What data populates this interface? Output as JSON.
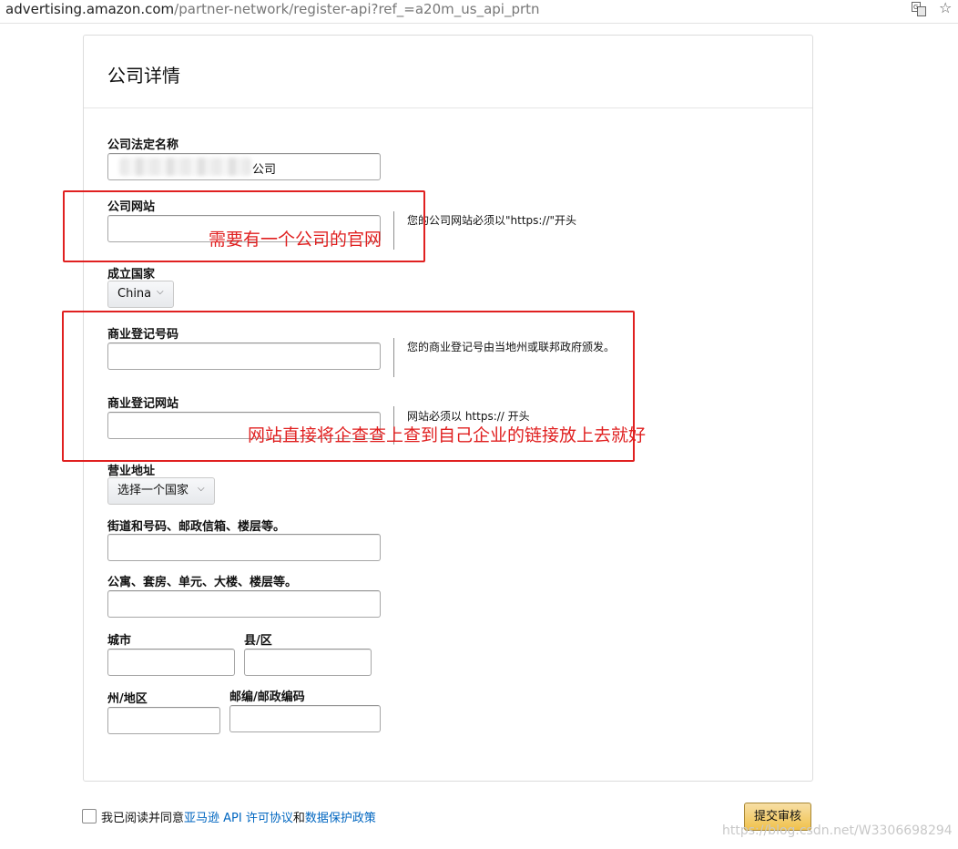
{
  "browser": {
    "url_host": "advertising.amazon.com",
    "url_path": "/partner-network/register-api?ref_=a20m_us_api_prtn"
  },
  "card": {
    "title": "公司详情"
  },
  "form": {
    "legal_name": {
      "label": "公司法定名称",
      "value": "公司"
    },
    "website": {
      "label": "公司网站",
      "help": "您的公司网站必须以\"https://\"开头"
    },
    "country": {
      "label": "成立国家",
      "selected": "China"
    },
    "reg_number": {
      "label": "商业登记号码",
      "help": "您的商业登记号由当地州或联邦政府颁发。"
    },
    "reg_website": {
      "label": "商业登记网站",
      "help": "网站必须以 https:// 开头"
    },
    "business_address": {
      "label": "营业地址",
      "selected": "选择一个国家"
    },
    "street": {
      "label": "街道和号码、邮政信箱、楼层等。"
    },
    "apartment": {
      "label": "公寓、套房、单元、大楼、楼层等。"
    },
    "city": {
      "label": "城市"
    },
    "county": {
      "label": "县/区"
    },
    "state": {
      "label": "州/地区"
    },
    "postal": {
      "label": "邮编/邮政编码"
    }
  },
  "annotations": {
    "website_note": "需要有一个公司的官网",
    "registration_note": "网站直接将企查查上查到自己企业的链接放上去就好"
  },
  "footer": {
    "agree_prefix": "我已阅读并同意",
    "license_link": "亚马逊 API 许可协议",
    "and": "和",
    "privacy_link": "数据保护政策",
    "submit_label": "提交审核"
  },
  "watermark": "https://blog.csdn.net/W3306698294",
  "colors": {
    "annotation_red": "#e02020",
    "link_blue": "#0066c0",
    "submit_yellow": "#f0c14b"
  }
}
